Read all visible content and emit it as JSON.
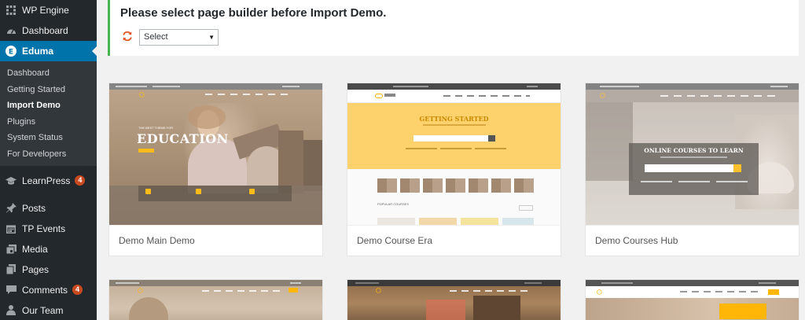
{
  "sidebar": {
    "top_items": [
      {
        "label": "WP Engine",
        "icon": "grid-icon"
      },
      {
        "label": "Dashboard",
        "icon": "gauge-icon"
      },
      {
        "label": "Eduma",
        "icon": "eduma-icon"
      }
    ],
    "submenu": [
      "Dashboard",
      "Getting Started",
      "Import Demo",
      "Plugins",
      "System Status",
      "For Developers"
    ],
    "learnpress": {
      "label": "LearnPress",
      "badge": "4"
    },
    "bottom_items": [
      {
        "label": "Posts",
        "icon": "pin-icon"
      },
      {
        "label": "TP Events",
        "icon": "calendar-icon"
      },
      {
        "label": "Media",
        "icon": "media-icon"
      },
      {
        "label": "Pages",
        "icon": "pages-icon"
      },
      {
        "label": "Comments",
        "icon": "comment-icon",
        "badge": "4"
      },
      {
        "label": "Our Team",
        "icon": "team-icon"
      }
    ]
  },
  "notice": {
    "message": "Please select page builder before Import Demo.",
    "select_value": "Select"
  },
  "demos": [
    {
      "caption": "Demo Main Demo",
      "hero_title": "EDUCATION",
      "hero_kicker": "THE BEST THEME FOR"
    },
    {
      "caption": "Demo Course Era",
      "hero_title": "GETTING STARTED",
      "section_label": "POPULAR COURSES"
    },
    {
      "caption": "Demo Courses Hub",
      "hero_title": "ONLINE COURSES TO LEARN"
    },
    {
      "caption": ""
    },
    {
      "caption": ""
    },
    {
      "caption": ""
    }
  ],
  "colors": {
    "sidebar_bg": "#23282d",
    "active_blue": "#0073aa",
    "notice_green": "#46b450",
    "badge_orange": "#ca4a1f",
    "eduma_yellow": "#ffb606"
  }
}
